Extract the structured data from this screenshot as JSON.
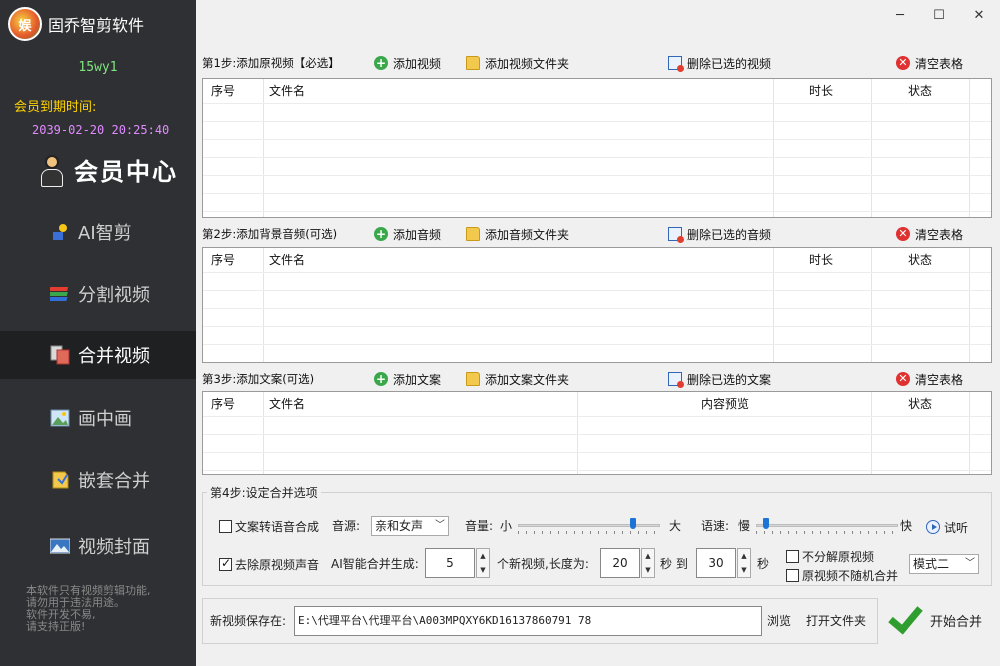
{
  "app": {
    "title": "固乔智剪软件",
    "logo_text": "娱"
  },
  "user": {
    "name": "15wy1",
    "expire_label": "会员到期时间:",
    "expire_time": "2039-02-20 20:25:40"
  },
  "member_center": "会员中心",
  "nav": [
    {
      "label": "AI智剪",
      "icon": "ai-cut-icon"
    },
    {
      "label": "分割视频",
      "icon": "split-video-icon"
    },
    {
      "label": "合并视频",
      "icon": "merge-video-icon",
      "active": true
    },
    {
      "label": "画中画",
      "icon": "picture-in-picture-icon"
    },
    {
      "label": "嵌套合并",
      "icon": "nest-merge-icon"
    },
    {
      "label": "视频封面",
      "icon": "video-cover-icon"
    }
  ],
  "notice": [
    "本软件只有视频剪辑功能,",
    "请勿用于违法用途。",
    "软件开发不易,",
    "请支持正版!"
  ],
  "window": {
    "minimize": "─",
    "maximize": "☐",
    "close": "✕"
  },
  "step1": {
    "label": "第1步:添加原视频【必选】",
    "add": "添加视频",
    "add_folder": "添加视频文件夹",
    "delete": "删除已选的视频",
    "clear": "清空表格",
    "columns": [
      "序号",
      "文件名",
      "时长",
      "状态"
    ]
  },
  "step2": {
    "label": "第2步:添加背景音频(可选)",
    "add": "添加音频",
    "add_folder": "添加音频文件夹",
    "delete": "删除已选的音频",
    "clear": "清空表格",
    "columns": [
      "序号",
      "文件名",
      "时长",
      "状态"
    ]
  },
  "step3": {
    "label": "第3步:添加文案(可选)",
    "add": "添加文案",
    "add_folder": "添加文案文件夹",
    "delete": "删除已选的文案",
    "clear": "清空表格",
    "columns": [
      "序号",
      "文件名",
      "内容预览",
      "状态"
    ]
  },
  "step4": {
    "title": "第4步:设定合并选项",
    "tts_label": "文案转语音合成",
    "tts_checked": false,
    "voice_label": "音源:",
    "voice_value": "亲和女声",
    "volume_label": "音量:",
    "volume_low": "小",
    "volume_high": "大",
    "volume_level": 0.82,
    "speed_label": "语速:",
    "speed_low": "慢",
    "speed_high": "快",
    "speed_level": 0.05,
    "listen": "试听",
    "remove_audio_label": "去除原视频声音",
    "remove_audio_checked": true,
    "ai_merge_label": "AI智能合并生成:",
    "count_value": "5",
    "count_suffix": "个新视频,长度为:",
    "min_len": "20",
    "to_label": "秒 到",
    "max_len": "30",
    "sec_label": "秒",
    "no_split_label": "不分解原视频",
    "no_split_checked": false,
    "no_random_label": "原视频不随机合并",
    "no_random_checked": false,
    "mode_value": "模式二"
  },
  "output": {
    "label": "新视频保存在:",
    "path": "E:\\代理平台\\代理平台\\A003MPQXY6KD16137860791 78",
    "browse": "浏览",
    "open_folder": "打开文件夹",
    "start": "开始合并"
  }
}
